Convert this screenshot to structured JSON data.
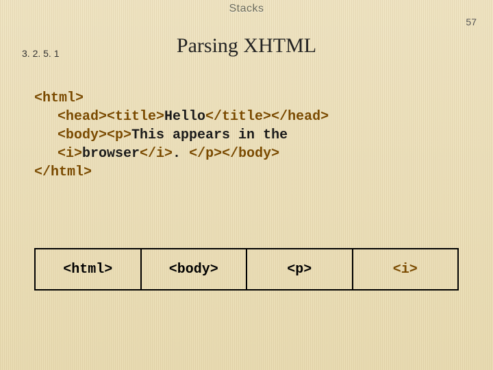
{
  "header": {
    "topic": "Stacks",
    "page_number": "57",
    "section_number": "3. 2. 5. 1",
    "title": "Parsing XHTML"
  },
  "code": {
    "line1_open": "<html>",
    "line2_a": "<head><title>",
    "line2_b": "Hello",
    "line2_c": "</title></head>",
    "line3_a": "<body><p>",
    "line3_b": "This appears in the",
    "line4_a": "<i>",
    "line4_b": "browser",
    "line4_c": "</i>",
    "line4_d": ". ",
    "line4_e": "</p></body>",
    "line5_close": "</html>"
  },
  "stack": {
    "cells": [
      "<html>",
      "<body>",
      "<p>",
      "<i>"
    ]
  }
}
